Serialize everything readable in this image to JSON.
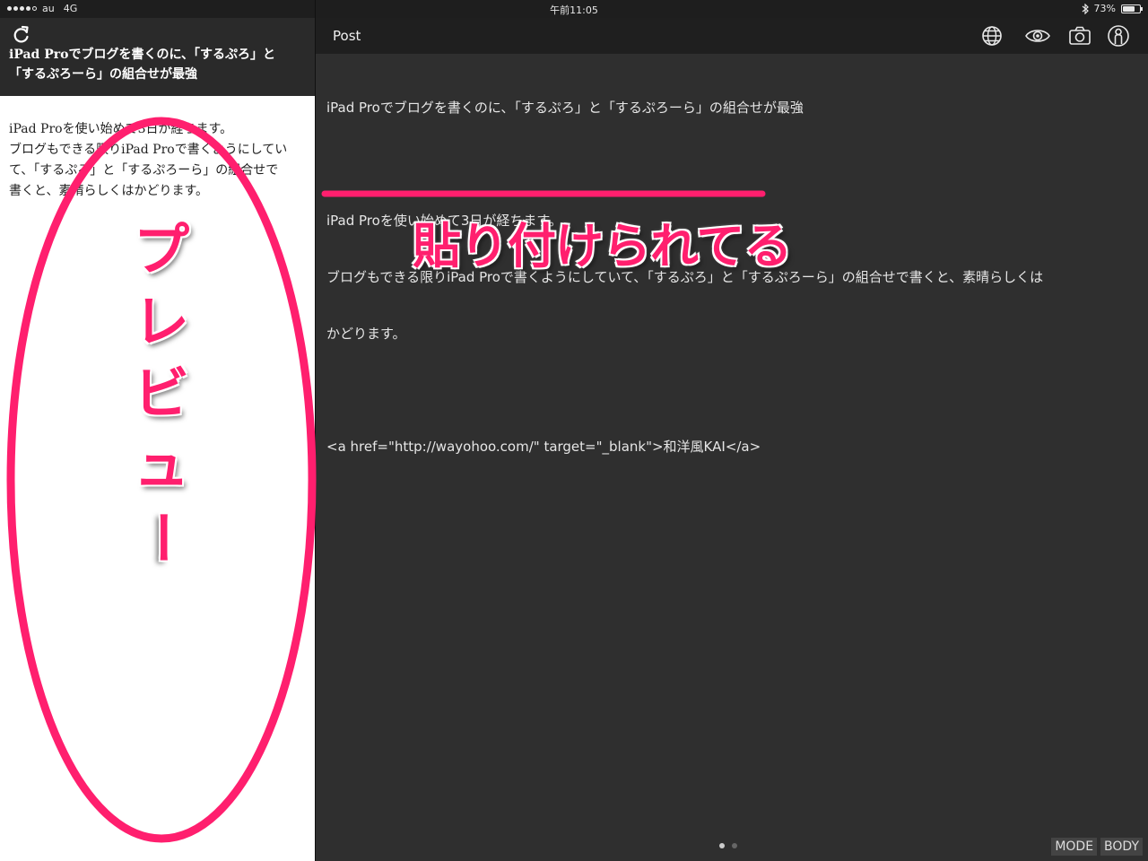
{
  "status_bar": {
    "carrier": "au",
    "network": "4G",
    "time": "午前11:05",
    "battery": "73%",
    "battery_level": 0.73
  },
  "preview": {
    "refresh_icon": "refresh-icon",
    "title_line1": "iPad Proでブログを書くのに、「するぷろ」と",
    "title_line2": "「するぷろーら」の組合せが最強",
    "body_line1": "iPad Proを使い始めて3日が経ちます。",
    "body_line2": "ブログもできる限りiPad Proで書くようにしてい",
    "body_line3": "て、「するぷろ」と「するぷろーら」の組合せで",
    "body_line4": "書くと、素晴らしくはかどります。"
  },
  "editor_header": {
    "title": "Post",
    "icons": [
      "globe-icon",
      "eye-icon",
      "camera-icon",
      "user-icon"
    ]
  },
  "editor": {
    "line1": "iPad Proでブログを書くのに、「するぷろ」と「するぷろーら」の組合せが最強",
    "line2": "",
    "line3": "iPad Proを使い始めて3日が経ちます。",
    "line4": "ブログもできる限りiPad Proで書くようにしていて、「するぷろ」と「するぷろーら」の組合せで書くと、素晴らしくは",
    "line5": "かどります。",
    "line6": "",
    "line7": "<a href=\"http://wayohoo.com/\" target=\"_blank\">和洋風KAI</a>"
  },
  "footer": {
    "mode_label": "MODE",
    "body_label": "BODY",
    "page_count": 2,
    "current_page": 1
  },
  "annotations": {
    "pasted": "貼り付けられてる",
    "preview_chars": [
      "プ",
      "レ",
      "ビ",
      "ュ",
      "ー"
    ],
    "color": "#ff1f6e"
  }
}
